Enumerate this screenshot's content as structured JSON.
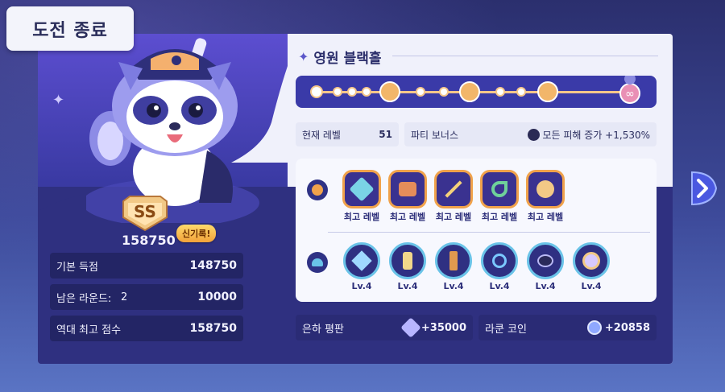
{
  "header": {
    "title": "도전 종료"
  },
  "stage": {
    "name": "영원 블랙홀"
  },
  "progress": {
    "nodes": 16,
    "final_icon": "infinity-icon"
  },
  "info": {
    "level_label": "현재 레벨",
    "level_value": "51",
    "party_bonus_label": "파티 보너스",
    "party_bonus_value": "모든 피해 증가 +1,530%"
  },
  "result": {
    "rank": "SS",
    "score": "158750",
    "new_record": "신기록!",
    "stats": [
      {
        "label": "기본 득점",
        "value": "148750"
      },
      {
        "label": "남은 라운드:",
        "sub": "2",
        "value": "10000"
      },
      {
        "label": "역대 최고 점수",
        "value": "158750"
      }
    ]
  },
  "items_max": {
    "icon": "orb-icon",
    "items": [
      {
        "label": "최고 레벨",
        "icon": "hammer-icon"
      },
      {
        "label": "최고 레벨",
        "icon": "boots-icon"
      },
      {
        "label": "최고 레벨",
        "icon": "crossbow-icon"
      },
      {
        "label": "최고 레벨",
        "icon": "scythe-icon"
      },
      {
        "label": "최고 레벨",
        "icon": "shield-icon"
      }
    ]
  },
  "items_lv": {
    "icon": "cap-icon",
    "items": [
      {
        "label": "Lv.4",
        "icon": "crystal-icon"
      },
      {
        "label": "Lv.4",
        "icon": "scroll-icon"
      },
      {
        "label": "Lv.4",
        "icon": "quiver-icon"
      },
      {
        "label": "Lv.4",
        "icon": "chain-icon"
      },
      {
        "label": "Lv.4",
        "icon": "pet-icon"
      },
      {
        "label": "Lv.4",
        "icon": "clock-icon"
      }
    ]
  },
  "rewards": [
    {
      "label": "은하 평판",
      "value": "+35000",
      "icon": "galaxy-icon"
    },
    {
      "label": "라쿤 코인",
      "value": "+20858",
      "icon": "coin-icon"
    }
  ],
  "colors": {
    "accent": "#3a3aa8",
    "gold": "#f0a24b",
    "dark_panel": "#2a2b75"
  }
}
